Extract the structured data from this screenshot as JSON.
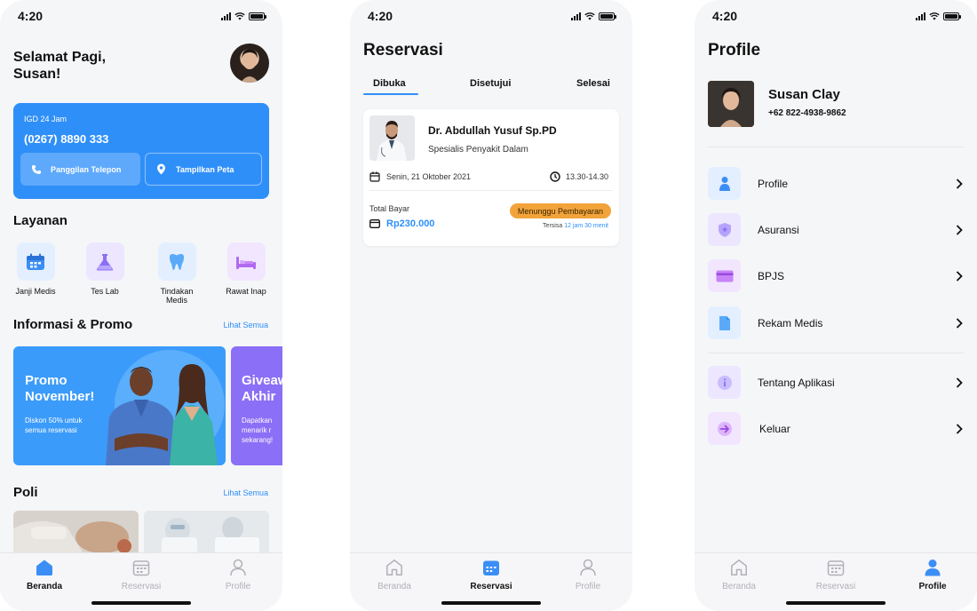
{
  "status": {
    "time": "4:20"
  },
  "nav": {
    "home": "Beranda",
    "reservations": "Reservasi",
    "profile": "Profile"
  },
  "home": {
    "greeting_line1": "Selamat Pagi,",
    "greeting_line2": "Susan!",
    "igd": {
      "label": "IGD 24 Jam",
      "phone": "(0267) 8890 333",
      "call_button": "Panggilan Telepon",
      "map_button": "Tampilkan Peta"
    },
    "services_title": "Layanan",
    "services": [
      {
        "label": "Janji Medis",
        "icon": "calendar-icon",
        "color": "#3b8ef6"
      },
      {
        "label": "Tes Lab",
        "icon": "lab-icon",
        "color": "#8b6ff6"
      },
      {
        "label": "Tindakan Medis",
        "icon": "tooth-icon",
        "color": "#5aaaf8"
      },
      {
        "label": "Rawat Inap",
        "icon": "bed-icon",
        "color": "#b06af0"
      }
    ],
    "promo_title": "Informasi & Promo",
    "see_all": "Lihat Semua",
    "promos": [
      {
        "title": "Promo November!",
        "desc": "Diskon 50% untuk semua reservasi"
      },
      {
        "title": "Giveaw\nAkhir",
        "desc": "Dapatkan\nmenarik r\nsekarang!"
      }
    ],
    "poli_title": "Poli"
  },
  "reservations": {
    "title": "Reservasi",
    "tabs": [
      "Dibuka",
      "Disetujui",
      "Selesai"
    ],
    "active_tab": "Dibuka",
    "card": {
      "doctor": "Dr. Abdullah Yusuf Sp.PD",
      "specialty": "Spesialis Penyakit Dalam",
      "date": "Senin, 21 Oktober 2021",
      "time": "13.30-14.30",
      "total_label": "Total Bayar",
      "total": "Rp230.000",
      "status": "Menunggu Pembayaran",
      "remaining_prefix": "Tersisa",
      "remaining": "12 jam 30 menit"
    }
  },
  "profile": {
    "title": "Profile",
    "name": "Susan Clay",
    "phone": "+62 822-4938-9862",
    "menu": [
      {
        "label": "Profile",
        "icon": "person-icon"
      },
      {
        "label": "Asuransi",
        "icon": "shield-icon"
      },
      {
        "label": "BPJS",
        "icon": "card-icon"
      },
      {
        "label": "Rekam Medis",
        "icon": "document-icon"
      },
      {
        "label": "Tentang Aplikasi",
        "icon": "info-icon"
      },
      {
        "label": "Keluar",
        "icon": "logout-icon"
      }
    ]
  },
  "colors": {
    "primary": "#2f8ff8",
    "badge": "#f2a33a",
    "purple": "#8b6ff6"
  }
}
